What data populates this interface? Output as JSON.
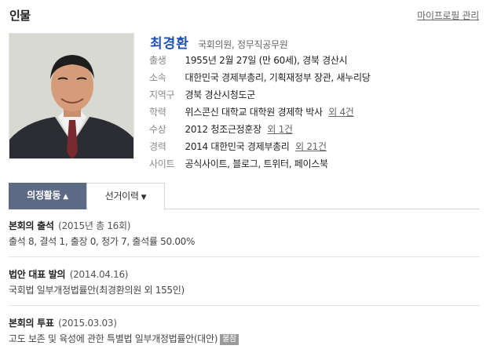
{
  "header": {
    "title": "인물",
    "profile_link": "마이프로필 관리"
  },
  "person": {
    "name": "최경환",
    "job": "국회의원, 정무직공무원",
    "info": {
      "birth": {
        "label": "출생",
        "value": "1955년 2월 27일 (만 60세), 경북 경산시"
      },
      "affiliation": {
        "label": "소속",
        "part1": "대한민국",
        "part2": "경제부총리,",
        "part3": "기획재정부",
        "part4": "장관,",
        "part5": "새누리당"
      },
      "district": {
        "label": "지역구",
        "value": "경북 경산시청도군"
      },
      "education": {
        "label": "학력",
        "school": "위스콘신 대학교 대학원",
        "degree": "경제학 박사",
        "more": "외 4건"
      },
      "award": {
        "label": "수상",
        "value": "2012 청조근정훈장",
        "more": "외 1건"
      },
      "career": {
        "label": "경력",
        "value": "2014 대한민국 경제부총리",
        "more": "외 21건"
      },
      "sites": {
        "label": "사이트",
        "s1": "공식사이트,",
        "s2": "블로그,",
        "s3": "트위터,",
        "s4": "페이스북"
      }
    }
  },
  "tabs": {
    "active_label": "의정활동",
    "active_icon": "chevron-up-icon",
    "inactive_label": "선거이력",
    "inactive_icon": "chevron-down-icon"
  },
  "activities": {
    "attendance": {
      "title": "본회의 출석",
      "sub": "(2015년 총 16회)",
      "body": "출석 8, 결석 1, 출장 0, 청가 7, 출석률 50.00%"
    },
    "bill": {
      "title": "법안 대표 발의",
      "sub": "(2014.04.16)",
      "body": "국회법 일부개정법률안(최경환의원 외 155인)"
    },
    "vote": {
      "title": "본회의 투표",
      "sub": "(2015.03.03)",
      "body": "고도 보존 및 육성에 관한 특별법 일부개정법률안(대안)",
      "badge": "불참"
    }
  },
  "colors": {
    "link_blue": "#1f4fb5",
    "tab_active_bg": "#5c6a85",
    "badge_bg": "#9a9a9a"
  }
}
